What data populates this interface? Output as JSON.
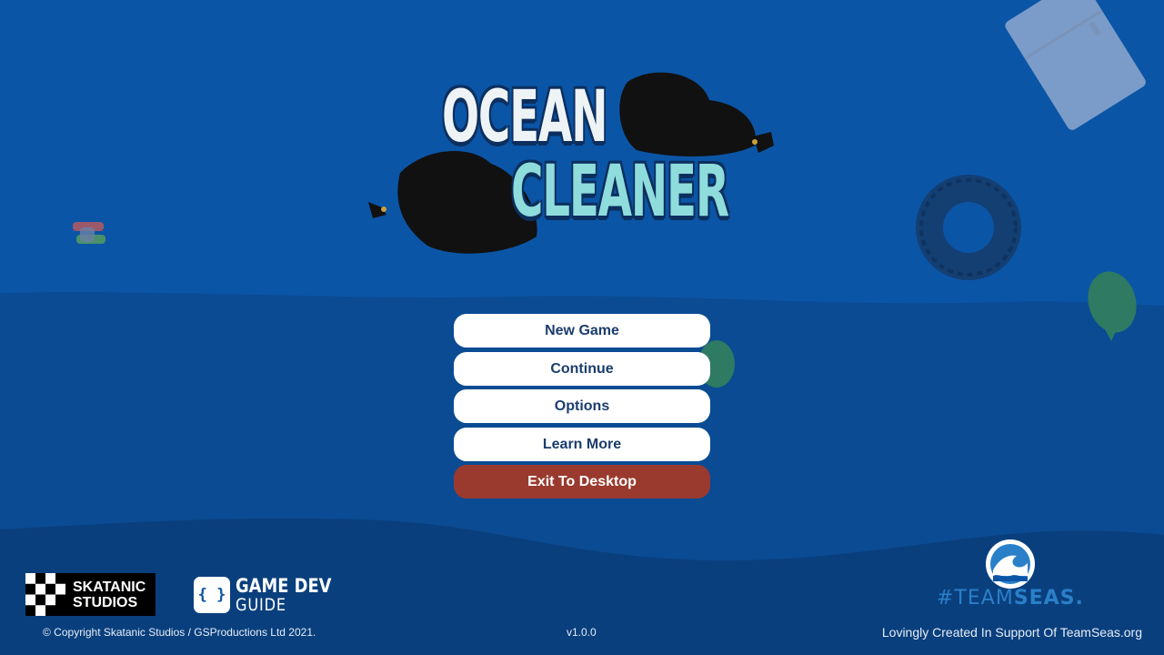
{
  "title": {
    "line1": "OCEAN",
    "line2": "CLEANER"
  },
  "menu": {
    "items": [
      {
        "label": "New Game"
      },
      {
        "label": "Continue"
      },
      {
        "label": "Options"
      },
      {
        "label": "Learn More"
      },
      {
        "label": "Exit To Desktop"
      }
    ]
  },
  "footer": {
    "copyright": "© Copyright Skatanic Studios / GSProductions Ltd 2021.",
    "version": "v1.0.0",
    "support": "Lovingly Created In Support Of TeamSeas.org"
  },
  "logos": {
    "skatanic_line1": "SKATANIC",
    "skatanic_line2": "STUDIOS",
    "gamedev_line1": "GAME DEV",
    "gamedev_line2": "GUIDE",
    "gamedev_icon": "{ }",
    "teamseas_prefix": "#TEAM",
    "teamseas_suffix": "SEAS."
  },
  "colors": {
    "ocean_top": "#0b55a6",
    "ocean_mid": "#0a4b93",
    "ocean_deep": "#0a3f7d",
    "button_bg": "#ffffff",
    "button_text": "#1b3d6d",
    "exit_bg": "#9a3a2e"
  },
  "icons": [
    "trash-bag-icon",
    "tire-icon",
    "fridge-icon",
    "plastic-bag-icon",
    "fish-icon",
    "wave-icon"
  ]
}
